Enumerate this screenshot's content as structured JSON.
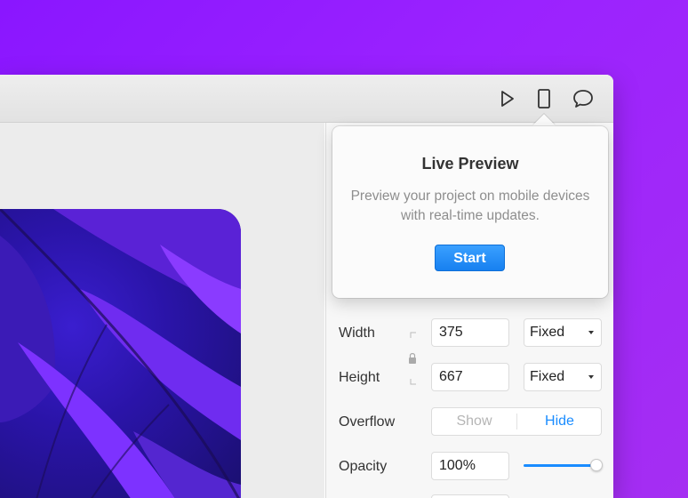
{
  "toolbar": {
    "icons": [
      "play-icon",
      "device-preview-icon",
      "comment-icon"
    ]
  },
  "popover": {
    "title": "Live Preview",
    "description": "Preview your project on mobile devices with real-time updates.",
    "start_label": "Start"
  },
  "properties": {
    "width": {
      "label": "Width",
      "value": "375",
      "mode": "Fixed"
    },
    "height": {
      "label": "Height",
      "value": "667",
      "mode": "Fixed"
    },
    "overflow": {
      "label": "Overflow",
      "options": [
        "Show",
        "Hide"
      ],
      "selected": "Hide"
    },
    "opacity": {
      "label": "Opacity",
      "value": "100%",
      "slider_value": 1.0
    }
  },
  "colors": {
    "background": "#9b22ff",
    "accent": "#1a8cff",
    "start_button": "#1780f0"
  }
}
